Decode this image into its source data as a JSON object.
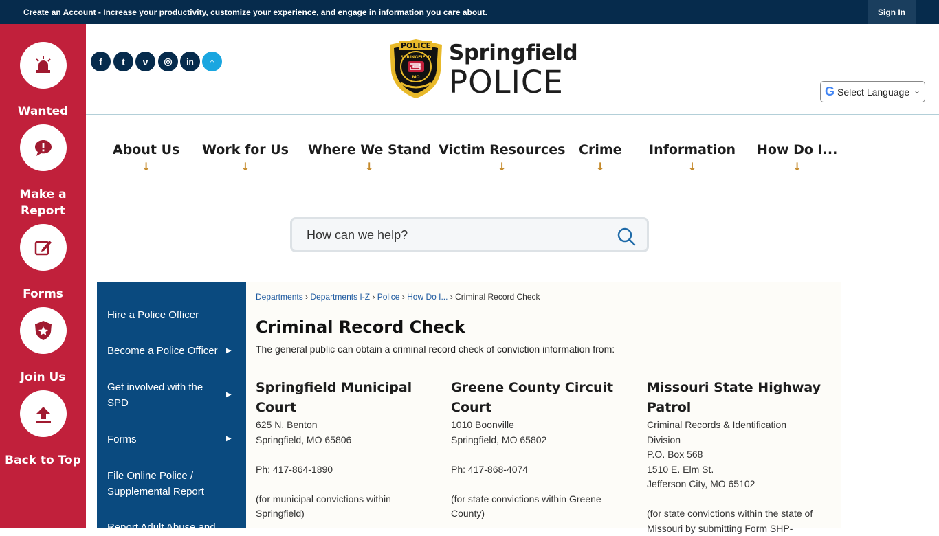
{
  "topbar": {
    "account_link": "Create an Account",
    "message": " - Increase your productivity, customize your experience, and engage in information you care about.",
    "signin": "Sign In"
  },
  "rail": [
    {
      "label": "Wanted",
      "icon": "siren-icon"
    },
    {
      "label": "Make a Report",
      "icon": "alert-chat-icon"
    },
    {
      "label": "Forms",
      "icon": "form-edit-icon"
    },
    {
      "label": "Join Us",
      "icon": "badge-star-icon"
    },
    {
      "label": "Back to Top",
      "icon": "arrow-up-icon"
    }
  ],
  "social": [
    {
      "name": "facebook-icon",
      "glyph": "f"
    },
    {
      "name": "twitter-icon",
      "glyph": "t"
    },
    {
      "name": "vimeo-icon",
      "glyph": "v"
    },
    {
      "name": "instagram-icon",
      "glyph": "◎"
    },
    {
      "name": "linkedin-icon",
      "glyph": "in"
    },
    {
      "name": "nextdoor-icon",
      "glyph": "⌂"
    }
  ],
  "logo": {
    "word1": "Springfield",
    "word2": "POLICE",
    "badge_top": "POLICE",
    "badge_ring": "SPRINGFIELD",
    "badge_bottom": "MO"
  },
  "language": {
    "label": "Select Language"
  },
  "nav": [
    "About Us",
    "Work for Us",
    "Where We Stand",
    "Victim Resources",
    "Crime",
    "Information",
    "How Do I..."
  ],
  "search": {
    "placeholder": "How can we help?"
  },
  "sidenav": [
    {
      "label": "Hire a Police Officer",
      "arrow": false
    },
    {
      "label": "Become a Police Officer",
      "arrow": true
    },
    {
      "label": "Get involved with the SPD",
      "arrow": true
    },
    {
      "label": "Forms",
      "arrow": true
    },
    {
      "label": "File Online Police / Supplemental Report",
      "arrow": false
    },
    {
      "label": "Report Adult Abuse and",
      "arrow": false
    }
  ],
  "breadcrumbs": [
    "Departments",
    "Departments I-Z",
    "Police",
    "How Do I...",
    "Criminal Record Check"
  ],
  "page": {
    "title": "Criminal Record Check",
    "intro": "The general public can obtain a criminal record check of conviction information from:"
  },
  "columns": [
    {
      "heading": "Springfield Municipal Court",
      "lines": [
        "625 N. Benton",
        "Springfield, MO 65806",
        "",
        "Ph: 417-864-1890",
        "",
        "(for municipal convictions within",
        "Springfield)"
      ]
    },
    {
      "heading": "Greene County Circuit Court",
      "lines": [
        "1010 Boonville",
        "Springfield, MO 65802",
        "",
        "Ph: 417-868-4074",
        "",
        "(for state convictions within Greene",
        "County)"
      ]
    },
    {
      "heading": "Missouri State Highway Patrol",
      "lines": [
        "Criminal Records & Identification",
        "Division",
        "P.O. Box 568",
        "1510 E. Elm St.",
        "Jefferson City, MO 65102",
        "",
        "(for state convictions within the state of",
        "Missouri by submitting Form SHP-"
      ]
    }
  ],
  "colors": {
    "topbar": "#062b4c",
    "rail": "#c1203b",
    "sidenav": "#0a4a7f",
    "accent": "#c58a2b",
    "link": "#1e5aa0"
  }
}
